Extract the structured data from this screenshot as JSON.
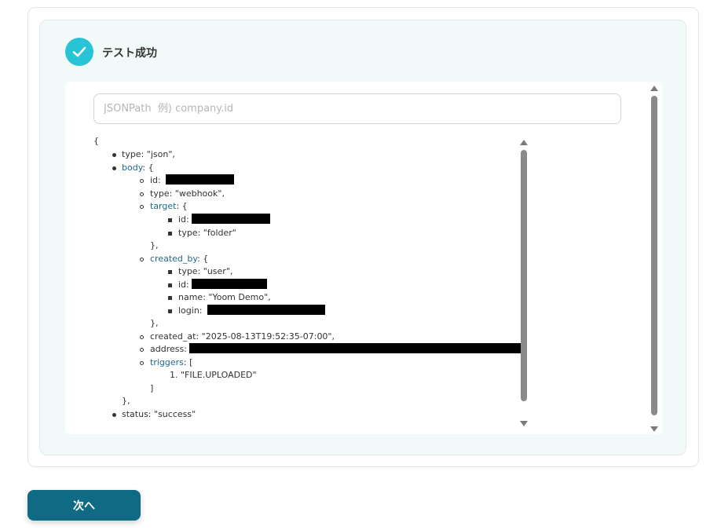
{
  "status": {
    "title": "テスト成功",
    "icon": "check-circle-icon",
    "color": "#28c3d4"
  },
  "jsonpath": {
    "placeholder": "JSONPath  例) company.id",
    "value": ""
  },
  "tree": {
    "open_brace": "{",
    "type_line": "type: \"json\",",
    "body_key": "body",
    "body_suffix": ": {",
    "body_id": "id:",
    "body_type": "type: \"webhook\",",
    "target_key": "target",
    "target_suffix": ": {",
    "target_id": "id:",
    "target_type": "type: \"folder\"",
    "target_close": "},",
    "created_by_key": "created_by",
    "created_by_suffix": ": {",
    "created_by_type": "type: \"user\",",
    "created_by_id": "id:",
    "created_by_name": "name: \"Yoom Demo\",",
    "created_by_login": "login:",
    "created_by_close": "},",
    "created_at": "created_at: \"2025-08-13T19:52:35-07:00\",",
    "address": "address:",
    "triggers_key": "triggers",
    "triggers_suffix": ": [",
    "trigger_item": "1. \"FILE.UPLOADED\"",
    "triggers_close": "]",
    "body_close": "},",
    "status_line": "status: \"success\""
  },
  "buttons": {
    "next_label": "次へ"
  },
  "colors": {
    "accent": "#0f6a83",
    "panel_bg": "#f1faf9",
    "key_link": "#1f6a8a"
  }
}
